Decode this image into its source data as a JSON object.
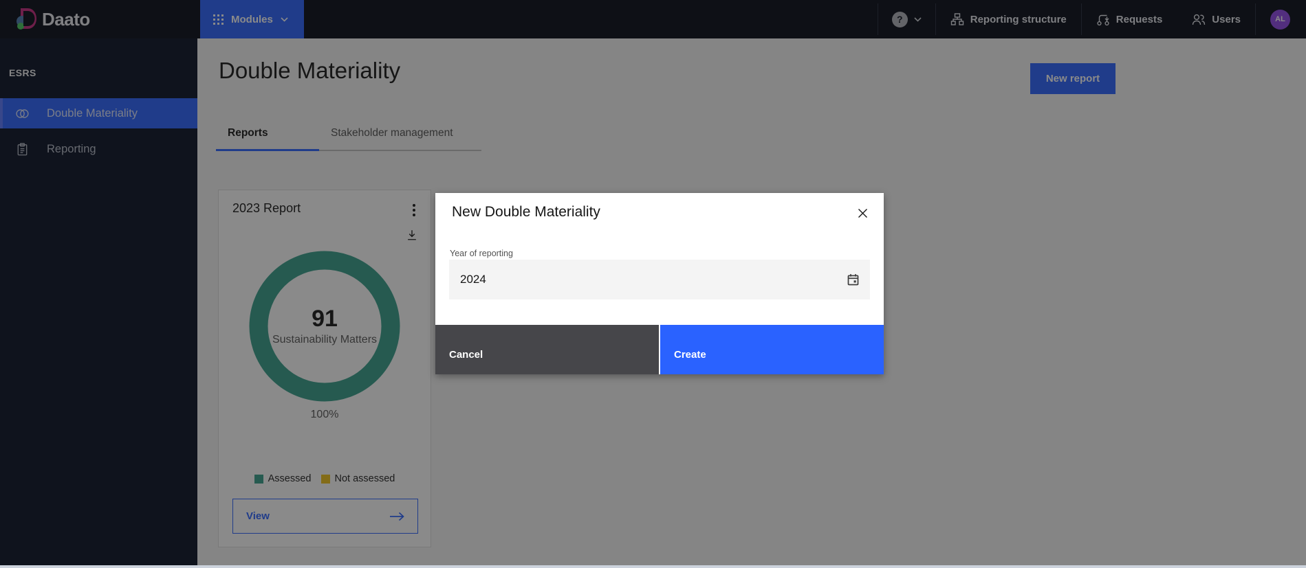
{
  "topbar": {
    "logo_text": "Daato",
    "modules_label": "Modules",
    "help_label": "?",
    "nav": [
      {
        "label": "Reporting structure"
      },
      {
        "label": "Requests"
      },
      {
        "label": "Users"
      }
    ],
    "avatar_initials": "AL"
  },
  "sidebar": {
    "section_label": "ESRS",
    "items": [
      {
        "label": "Double Materiality",
        "active": true
      },
      {
        "label": "Reporting",
        "active": false
      }
    ]
  },
  "page": {
    "title": "Double Materiality",
    "new_report_label": "New report",
    "tabs": [
      {
        "label": "Reports",
        "active": true
      },
      {
        "label": "Stakeholder management",
        "active": false
      }
    ]
  },
  "card": {
    "title": "2023 Report",
    "donut": {
      "type": "pie",
      "center_value": "91",
      "center_label": "Sustainability Matters",
      "percent_label": "100%",
      "series": [
        {
          "name": "Assessed",
          "value": 100,
          "color": "#369e8a"
        },
        {
          "name": "Not assessed",
          "value": 0,
          "color": "#f1c21b"
        }
      ]
    },
    "legend": [
      {
        "label": "Assessed",
        "color": "#369e8a"
      },
      {
        "label": "Not assessed",
        "color": "#f1c21b"
      }
    ],
    "view_label": "View"
  },
  "modal": {
    "title": "New Double Materiality",
    "field_label": "Year of reporting",
    "field_value": "2024",
    "cancel_label": "Cancel",
    "create_label": "Create"
  },
  "colors": {
    "primary_blue": "#2a62ff",
    "assessed_teal": "#369e8a",
    "not_assessed_yellow": "#f1c21b",
    "cancel_gray": "#46464a",
    "avatar_purple": "#8f46e6",
    "topbar_bg": "#070b16",
    "sidebar_bg": "#081024",
    "main_bg": "#f4f4f4"
  }
}
